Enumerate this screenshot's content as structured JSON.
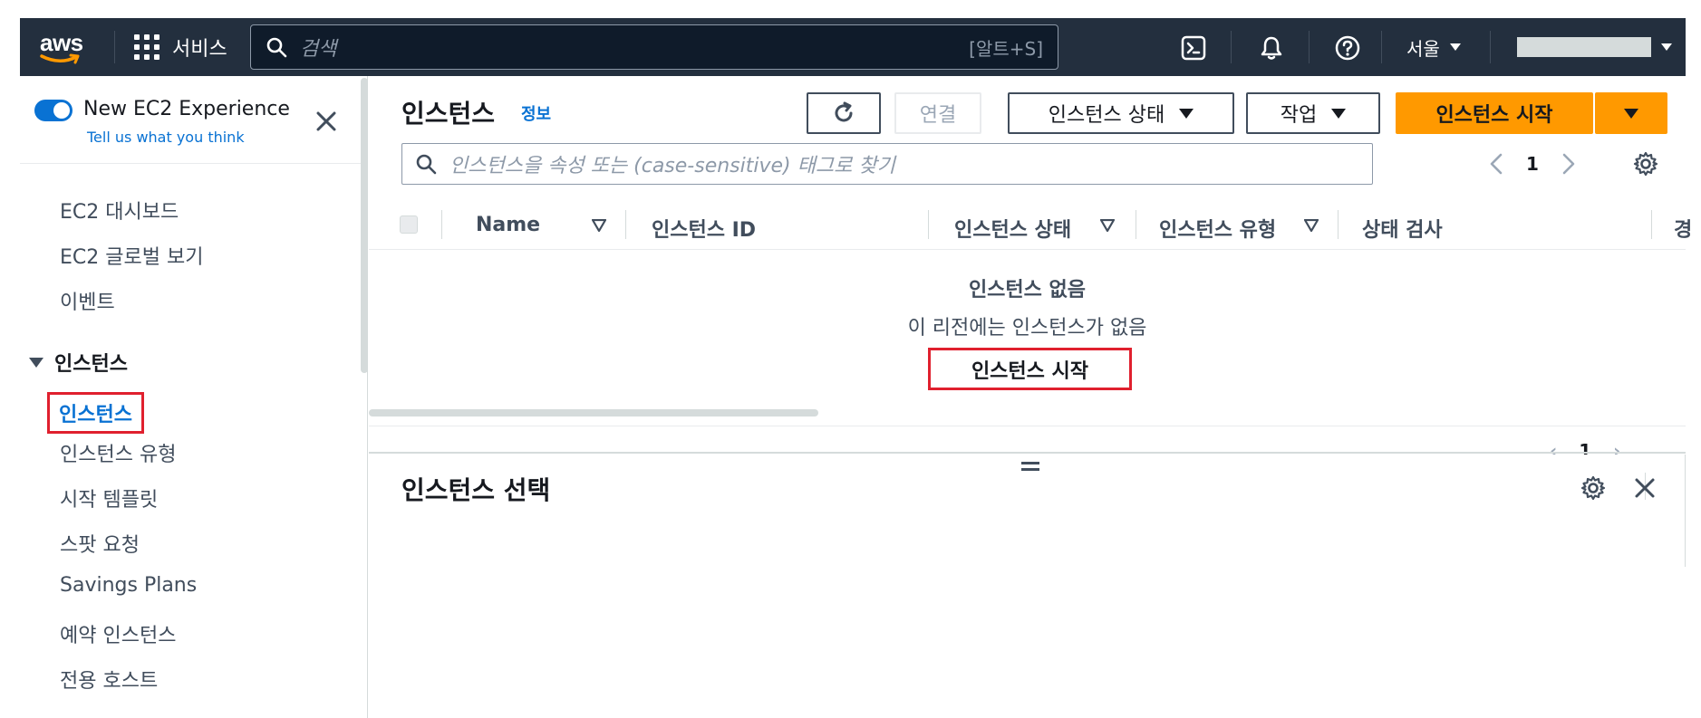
{
  "topbar": {
    "logo_text": "aws",
    "services_label": "서비스",
    "search_placeholder": "검색",
    "search_shortcut": "[알트+S]",
    "region_label": "서울"
  },
  "sidebar": {
    "experience_title": "New EC2 Experience",
    "experience_link": "Tell us what you think",
    "items": [
      {
        "label": "EC2 대시보드"
      },
      {
        "label": "EC2 글로벌 보기"
      },
      {
        "label": "이벤트"
      }
    ],
    "section": {
      "label": "인스턴스"
    },
    "section_items": [
      {
        "label": "인스턴스"
      },
      {
        "label": "인스턴스 유형"
      },
      {
        "label": "시작 템플릿"
      },
      {
        "label": "스팟 요청"
      },
      {
        "label": "Savings Plans"
      },
      {
        "label": "예약 인스턴스"
      },
      {
        "label": "전용 호스트"
      }
    ]
  },
  "main": {
    "title": "인스턴스",
    "info_link": "정보",
    "buttons": {
      "connect": "연결",
      "instance_state": "인스턴스 상태",
      "actions": "작업",
      "launch": "인스턴스 시작"
    },
    "filter_placeholder": "인스턴스을 속성 또는 (case-sensitive) 태그로 찾기",
    "page_number": "1",
    "columns": [
      "Name",
      "인스턴스 ID",
      "인스턴스 상태",
      "인스턴스 유형",
      "상태 검사",
      "경"
    ],
    "empty": {
      "title": "인스턴스 없음",
      "subtitle": "이 리전에는 인스턴스가 없음",
      "button": "인스턴스 시작"
    },
    "bottom_page_number": "1"
  },
  "split_panel": {
    "title": "인스턴스 선택"
  }
}
